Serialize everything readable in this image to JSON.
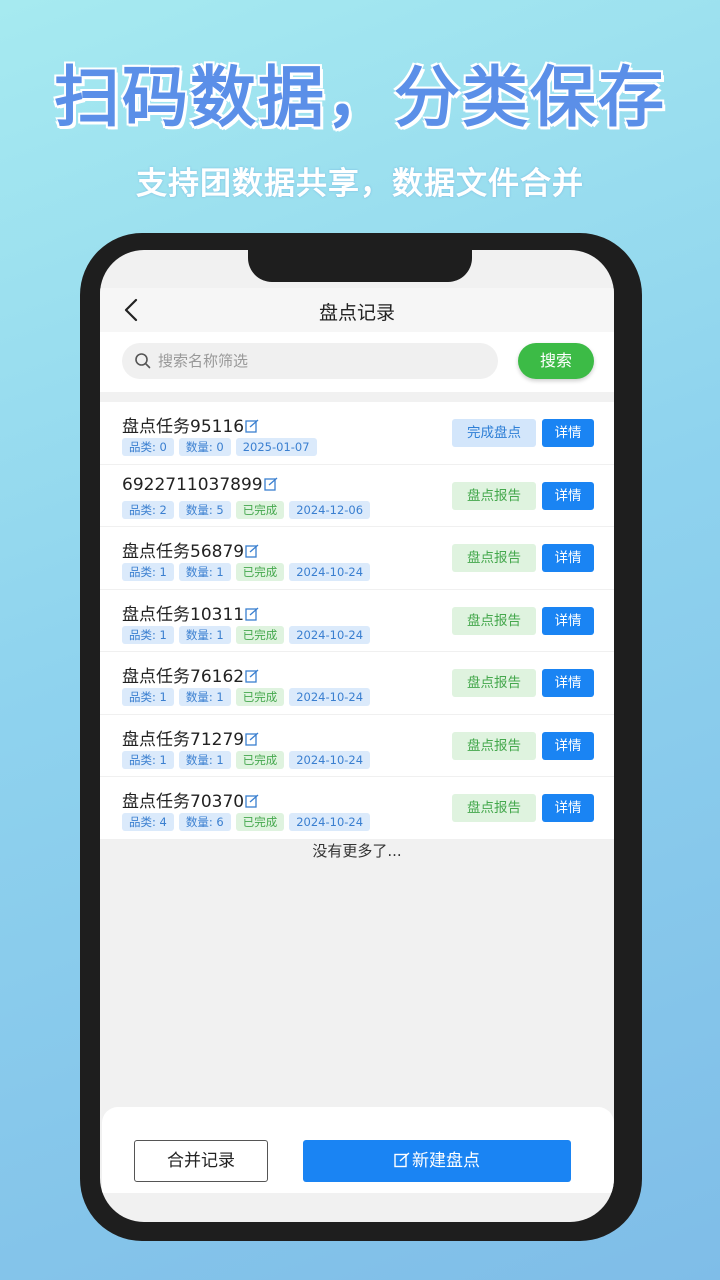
{
  "promo": {
    "title": "扫码数据，分类保存",
    "subtitle": "支持团数据共享，数据文件合并"
  },
  "header": {
    "title": "盘点记录"
  },
  "search": {
    "placeholder": "搜索名称筛选",
    "button_label": "搜索"
  },
  "records": [
    {
      "name": "盘点任务95116",
      "category": "品类: 0",
      "quantity": "数量: 0",
      "status": "",
      "date": "2025-01-07",
      "action": "完成盘点",
      "detail": "详情"
    },
    {
      "name": "6922711037899",
      "category": "品类: 2",
      "quantity": "数量: 5",
      "status": "已完成",
      "date": "2024-12-06",
      "action": "盘点报告",
      "detail": "详情"
    },
    {
      "name": "盘点任务56879",
      "category": "品类: 1",
      "quantity": "数量: 1",
      "status": "已完成",
      "date": "2024-10-24",
      "action": "盘点报告",
      "detail": "详情"
    },
    {
      "name": "盘点任务10311",
      "category": "品类: 1",
      "quantity": "数量: 1",
      "status": "已完成",
      "date": "2024-10-24",
      "action": "盘点报告",
      "detail": "详情"
    },
    {
      "name": "盘点任务76162",
      "category": "品类: 1",
      "quantity": "数量: 1",
      "status": "已完成",
      "date": "2024-10-24",
      "action": "盘点报告",
      "detail": "详情"
    },
    {
      "name": "盘点任务71279",
      "category": "品类: 1",
      "quantity": "数量: 1",
      "status": "已完成",
      "date": "2024-10-24",
      "action": "盘点报告",
      "detail": "详情"
    },
    {
      "name": "盘点任务70370",
      "category": "品类: 4",
      "quantity": "数量: 6",
      "status": "已完成",
      "date": "2024-10-24",
      "action": "盘点报告",
      "detail": "详情"
    }
  ],
  "list_footer": "没有更多了...",
  "footer": {
    "merge_label": "合并记录",
    "new_label": "新建盘点"
  },
  "colors": {
    "primary": "#1a84f3",
    "search_green": "#3cbb46",
    "done_green": "#45a84d",
    "promo_title": "#5b8fe8"
  }
}
